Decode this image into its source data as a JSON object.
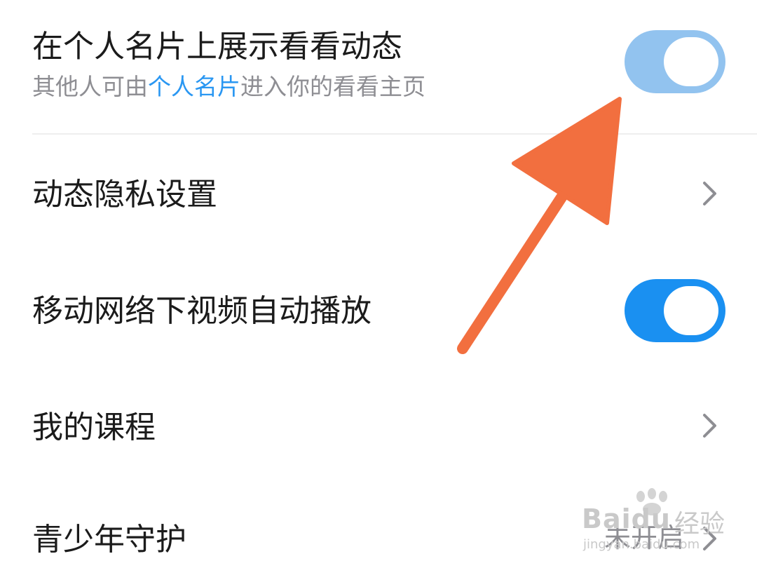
{
  "settings": {
    "show_on_card": {
      "title": "在个人名片上展示看看动态",
      "subtitle_prefix": "其他人可由",
      "subtitle_link": "个人名片",
      "subtitle_suffix": "进入你的看看主页",
      "toggle_state": "on-faded"
    },
    "privacy": {
      "title": "动态隐私设置"
    },
    "autoplay": {
      "title": "移动网络下视频自动播放",
      "toggle_state": "on"
    },
    "courses": {
      "title": "我的课程"
    },
    "youth": {
      "title": "青少年守护",
      "value": "未开启"
    }
  },
  "watermark": {
    "brand": "Baidu",
    "cn": "经验",
    "url": "jingyan.baidu.com"
  },
  "colors": {
    "accent": "#1a90f1",
    "accent_faded": "#92c3ef",
    "link": "#2a97f2",
    "annotation_arrow": "#f26f3f"
  }
}
